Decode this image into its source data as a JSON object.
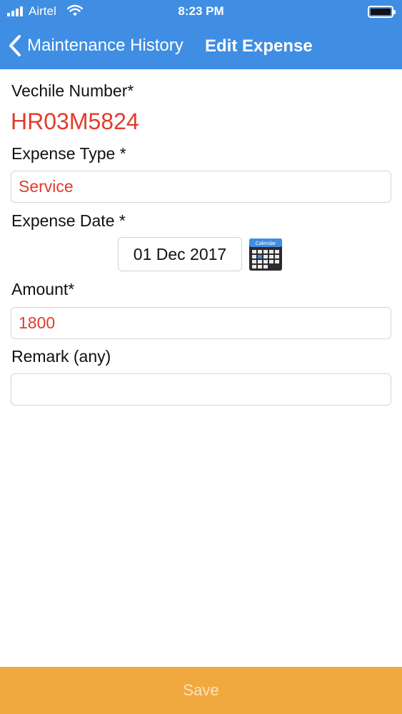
{
  "status_bar": {
    "carrier": "Airtel",
    "time": "8:23 PM"
  },
  "nav": {
    "back_label": "Maintenance History",
    "title": "Edit Expense"
  },
  "form": {
    "vehicle": {
      "label": "Vechile Number*",
      "value": "HR03M5824"
    },
    "expense_type": {
      "label": "Expense Type *",
      "value": "Service"
    },
    "expense_date": {
      "label": "Expense Date *",
      "value": "01 Dec 2017",
      "calendar_text": "Calendar"
    },
    "amount": {
      "label": "Amount*",
      "value": "1800"
    },
    "remark": {
      "label": "Remark (any)",
      "value": ""
    }
  },
  "footer": {
    "save_label": "Save"
  },
  "colors": {
    "nav_bg": "#3f8ee3",
    "value_red": "#e23b2b",
    "save_bg": "#f0a93e"
  },
  "icons": [
    "signal-icon",
    "wifi-icon",
    "battery-icon",
    "back-chevron-icon",
    "calendar-icon"
  ]
}
